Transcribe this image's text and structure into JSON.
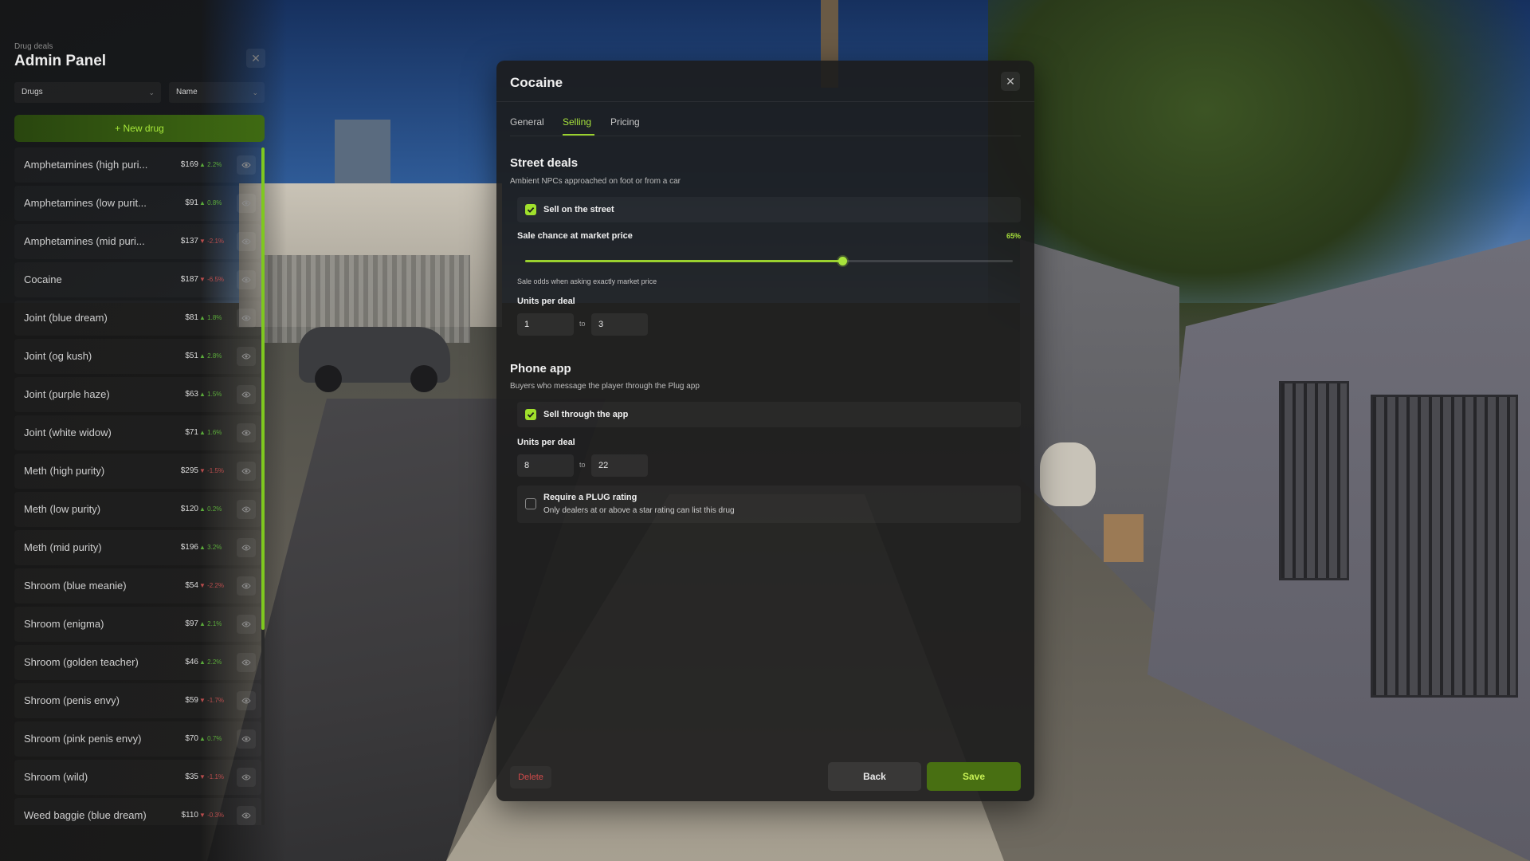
{
  "sidebar": {
    "kicker": "Drug deals",
    "title": "Admin Panel",
    "filter_category": "Drugs",
    "filter_sort": "Name",
    "new_button": "+ New drug",
    "items": [
      {
        "name": "Amphetamines (high puri...",
        "price": "$169",
        "delta": "▲ 2.2%",
        "trend": "up"
      },
      {
        "name": "Amphetamines (low purit...",
        "price": "$91",
        "delta": "▲ 0.8%",
        "trend": "up"
      },
      {
        "name": "Amphetamines (mid puri...",
        "price": "$137",
        "delta": "▼ -2.1%",
        "trend": "down"
      },
      {
        "name": "Cocaine",
        "price": "$187",
        "delta": "▼ -6.5%",
        "trend": "down"
      },
      {
        "name": "Joint (blue dream)",
        "price": "$81",
        "delta": "▲ 1.8%",
        "trend": "up"
      },
      {
        "name": "Joint (og kush)",
        "price": "$51",
        "delta": "▲ 2.8%",
        "trend": "up"
      },
      {
        "name": "Joint (purple haze)",
        "price": "$63",
        "delta": "▲ 1.5%",
        "trend": "up"
      },
      {
        "name": "Joint (white widow)",
        "price": "$71",
        "delta": "▲ 1.6%",
        "trend": "up"
      },
      {
        "name": "Meth (high purity)",
        "price": "$295",
        "delta": "▼ -1.5%",
        "trend": "down"
      },
      {
        "name": "Meth (low purity)",
        "price": "$120",
        "delta": "▲ 0.2%",
        "trend": "up"
      },
      {
        "name": "Meth (mid purity)",
        "price": "$196",
        "delta": "▲ 3.2%",
        "trend": "up"
      },
      {
        "name": "Shroom (blue meanie)",
        "price": "$54",
        "delta": "▼ -2.2%",
        "trend": "down"
      },
      {
        "name": "Shroom (enigma)",
        "price": "$97",
        "delta": "▲ 2.1%",
        "trend": "up"
      },
      {
        "name": "Shroom (golden teacher)",
        "price": "$46",
        "delta": "▲ 2.2%",
        "trend": "up"
      },
      {
        "name": "Shroom (penis envy)",
        "price": "$59",
        "delta": "▼ -1.7%",
        "trend": "down"
      },
      {
        "name": "Shroom (pink penis envy)",
        "price": "$70",
        "delta": "▲ 0.7%",
        "trend": "up"
      },
      {
        "name": "Shroom (wild)",
        "price": "$35",
        "delta": "▼ -1.1%",
        "trend": "down"
      },
      {
        "name": "Weed baggie (blue dream)",
        "price": "$110",
        "delta": "▼ -0.3%",
        "trend": "down"
      }
    ]
  },
  "modal": {
    "title": "Cocaine",
    "tabs": [
      "General",
      "Selling",
      "Pricing"
    ],
    "active_tab": "Selling",
    "street": {
      "title": "Street deals",
      "subtitle": "Ambient NPCs approached on foot or from a car",
      "sell_label": "Sell on the street",
      "sell_checked": true,
      "chance_label": "Sale chance at market price",
      "chance_text": "65%",
      "chance_value": 0.65,
      "chance_help": "Sale odds when asking exactly market price",
      "units_label": "Units per deal",
      "units_min": "1",
      "units_to": "to",
      "units_max": "3"
    },
    "phone": {
      "title": "Phone app",
      "subtitle": "Buyers who message the player through the Plug app",
      "sell_label": "Sell through the app",
      "sell_checked": true,
      "units_label": "Units per deal",
      "units_min": "8",
      "units_to": "to",
      "units_max": "22",
      "rating_label": "Require a PLUG rating",
      "rating_sub": "Only dealers at or above a star rating can list this drug",
      "rating_checked": false
    },
    "buttons": {
      "delete": "Delete",
      "back": "Back",
      "save": "Save"
    }
  },
  "colors": {
    "accent": "#a8e33c",
    "save_bg": "#486f12",
    "delete": "#d14a4a",
    "trend_up": "#5aa93a",
    "trend_down": "#b84c4c"
  }
}
